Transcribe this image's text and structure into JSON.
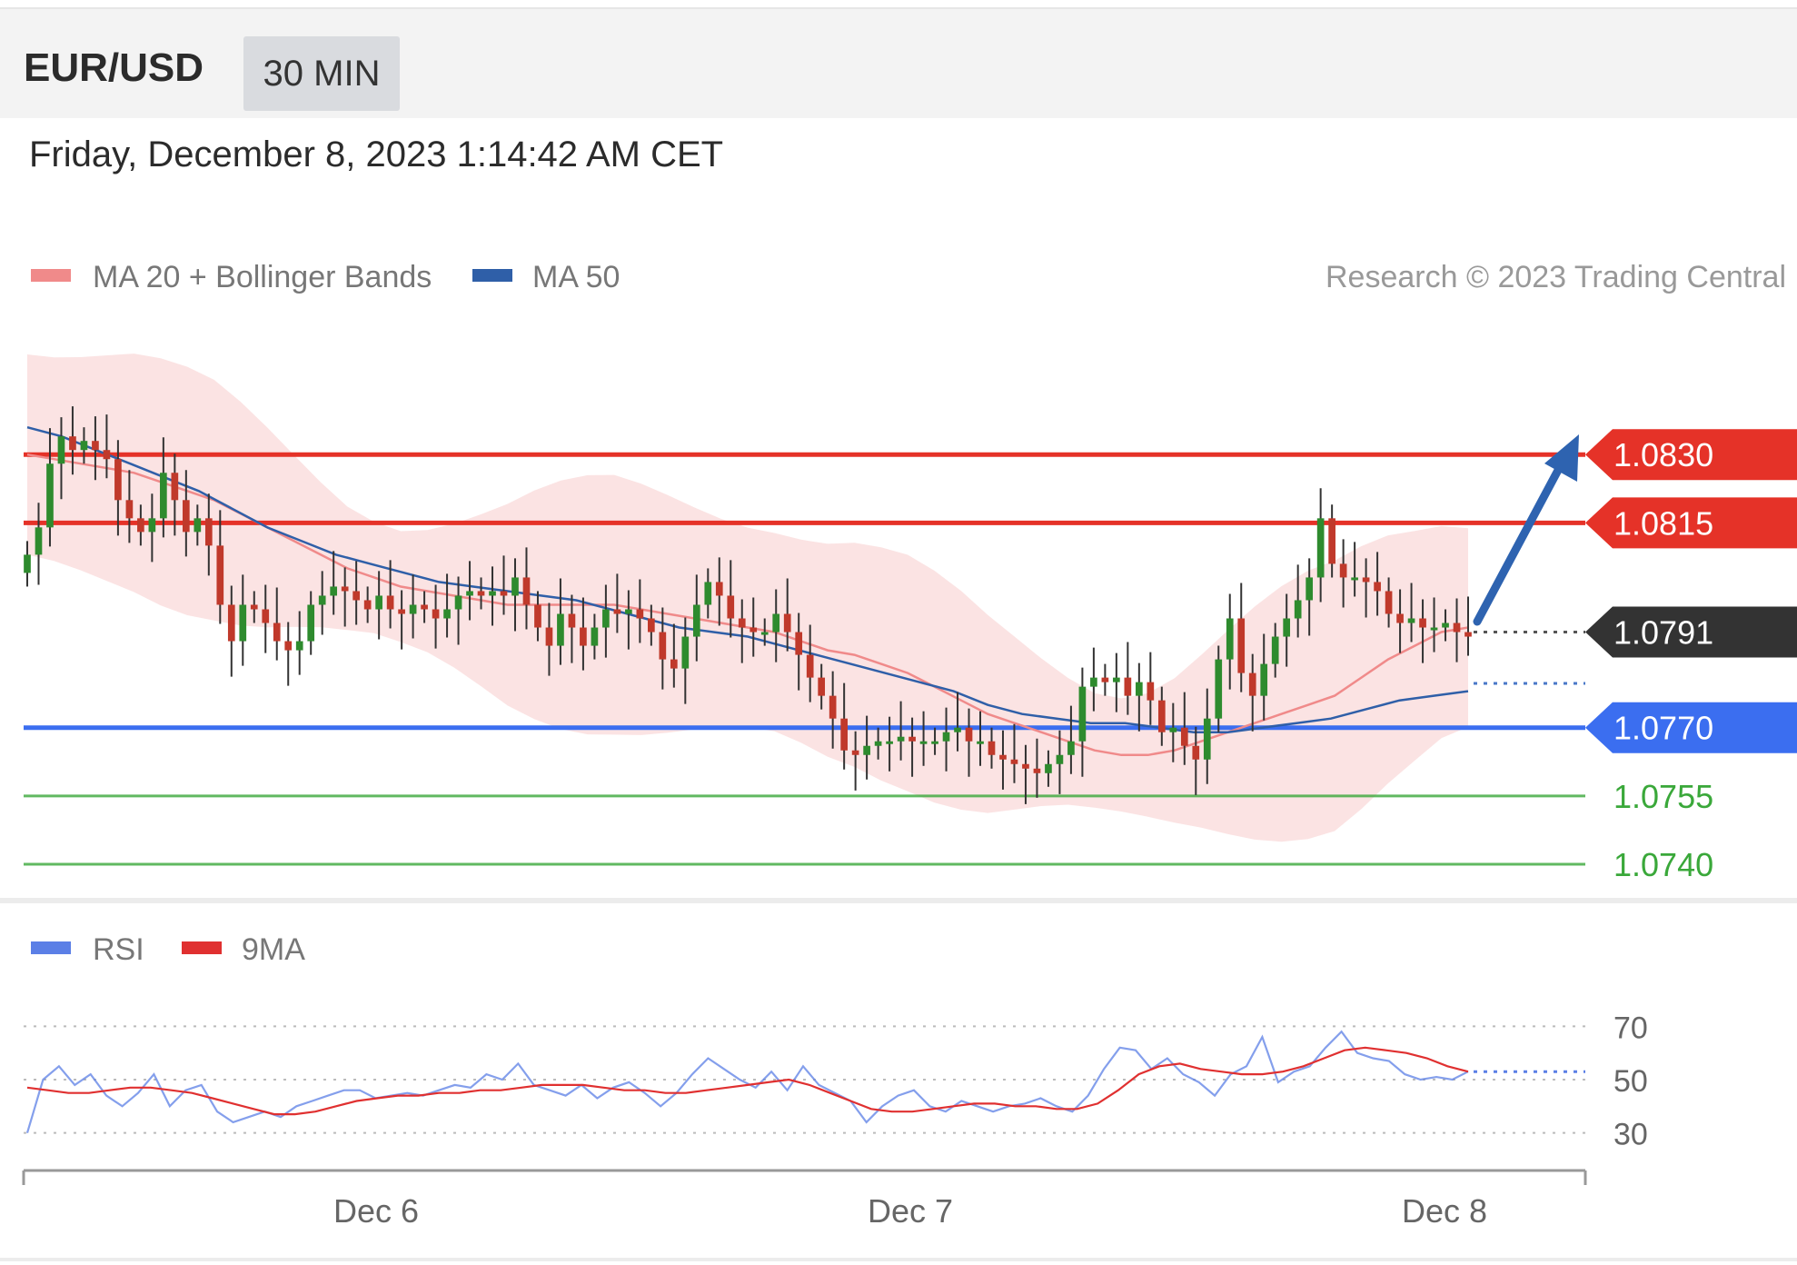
{
  "header": {
    "symbol": "EUR/USD",
    "timeframe": "30 MIN"
  },
  "datetime": "Friday, December 8, 2023 1:14:42 AM CET",
  "legend": {
    "ma20": {
      "label": "MA 20 + Bollinger Bands",
      "color": "#f08a8a"
    },
    "ma50": {
      "label": "MA 50",
      "color": "#2f5fa8"
    },
    "copyright": "Research © 2023 Trading Central"
  },
  "rsi_legend": {
    "rsi": {
      "label": "RSI",
      "color": "#5b7fe6"
    },
    "ma9": {
      "label": "9MA",
      "color": "#e03030"
    }
  },
  "colors": {
    "resistance": "#e53228",
    "support": "#3b6ef0",
    "target": "#3aa83a",
    "current": "#333333",
    "band": "#f9d9d9",
    "bull_candle": "#2e8b2e",
    "bear_candle": "#c0392b",
    "arrow": "#2e63b0"
  },
  "chart_data": [
    {
      "type": "candlestick",
      "title": "",
      "x_ticks": [
        "Dec 6",
        "Dec 7",
        "Dec 8"
      ],
      "ylim": [
        1.0733,
        1.0858
      ],
      "levels": [
        {
          "value": 1.083,
          "label": "1.0830",
          "kind": "resistance"
        },
        {
          "value": 1.0815,
          "label": "1.0815",
          "kind": "resistance"
        },
        {
          "value": 1.0791,
          "label": "1.0791",
          "kind": "current"
        },
        {
          "value": 1.077,
          "label": "1.0770",
          "kind": "support"
        },
        {
          "value": 1.0755,
          "label": "1.0755",
          "kind": "target"
        },
        {
          "value": 1.074,
          "label": "1.0740",
          "kind": "target"
        }
      ],
      "series": [
        {
          "name": "Price",
          "close": [
            1.0808,
            1.0814,
            1.0828,
            1.0834,
            1.0831,
            1.0833,
            1.0831,
            1.0829,
            1.082,
            1.0816,
            1.0813,
            1.0816,
            1.0826,
            1.082,
            1.0813,
            1.0816,
            1.081,
            1.0797,
            1.0789,
            1.0797,
            1.0796,
            1.0793,
            1.0789,
            1.0787,
            1.0789,
            1.0797,
            1.0799,
            1.0801,
            1.08,
            1.0798,
            1.0796,
            1.0799,
            1.0796,
            1.0795,
            1.0797,
            1.0796,
            1.0794,
            1.0796,
            1.0799,
            1.08,
            1.0799,
            1.08,
            1.0799,
            1.0803,
            1.0797,
            1.0792,
            1.0788,
            1.0795,
            1.0792,
            1.0788,
            1.0792,
            1.0796,
            1.0795,
            1.0796,
            1.0794,
            1.0791,
            1.0785,
            1.0783,
            1.079,
            1.0797,
            1.0802,
            1.0799,
            1.0794,
            1.0792,
            1.0791,
            1.0791,
            1.0795,
            1.0791,
            1.0786,
            1.0781,
            1.0777,
            1.0772,
            1.0765,
            1.0764,
            1.0766,
            1.0767,
            1.0767,
            1.0768,
            1.0767,
            1.0767,
            1.0767,
            1.0769,
            1.077,
            1.0767,
            1.0767,
            1.0764,
            1.0763,
            1.0762,
            1.0761,
            1.076,
            1.0762,
            1.0764,
            1.0767,
            1.0779,
            1.0781,
            1.078,
            1.0781,
            1.0777,
            1.078,
            1.0776,
            1.0769,
            1.077,
            1.0766,
            1.0763,
            1.0772,
            1.0785,
            1.0794,
            1.0782,
            1.0777,
            1.0784,
            1.079,
            1.0794,
            1.0798,
            1.0803,
            1.0816,
            1.0806,
            1.0803,
            1.0803,
            1.0802,
            1.08,
            1.0795,
            1.0793,
            1.0794,
            1.0792,
            1.0792,
            1.0793,
            1.0791,
            1.079
          ],
          "label_note": ""
        },
        {
          "name": "MA 20",
          "values": [
            1.083,
            1.0829,
            1.0828,
            1.0827,
            1.0826,
            1.0824,
            1.0822,
            1.082,
            1.0817,
            1.0814,
            1.0811,
            1.0808,
            1.0805,
            1.0803,
            1.0801,
            1.08,
            1.0799,
            1.0798,
            1.0797,
            1.0797,
            1.0797,
            1.0797,
            1.0797,
            1.0796,
            1.0795,
            1.0794,
            1.0793,
            1.0792,
            1.0791,
            1.0789,
            1.0787,
            1.0786,
            1.0784,
            1.0782,
            1.0779,
            1.0776,
            1.0773,
            1.0771,
            1.0769,
            1.0767,
            1.0765,
            1.0764,
            1.0764,
            1.0765,
            1.0767,
            1.0769,
            1.0771,
            1.0773,
            1.0775,
            1.0777,
            1.0781,
            1.0785,
            1.0788,
            1.0791,
            1.0792
          ]
        },
        {
          "name": "MA 50",
          "values": [
            1.0836,
            1.0834,
            1.0831,
            1.0828,
            1.0825,
            1.0822,
            1.0818,
            1.0814,
            1.0811,
            1.0808,
            1.0806,
            1.0804,
            1.0802,
            1.0801,
            1.08,
            1.0799,
            1.0798,
            1.0796,
            1.0794,
            1.0792,
            1.0791,
            1.079,
            1.0788,
            1.0786,
            1.0784,
            1.0782,
            1.078,
            1.0778,
            1.0775,
            1.0773,
            1.0772,
            1.0771,
            1.0771,
            1.077,
            1.0769,
            1.0769,
            1.077,
            1.0771,
            1.0772,
            1.0774,
            1.0776,
            1.0777,
            1.0778
          ]
        }
      ]
    },
    {
      "type": "line",
      "title": "",
      "y_ticks": [
        "70",
        "50",
        "30"
      ],
      "ylim": [
        20,
        80
      ],
      "series": [
        {
          "name": "RSI",
          "values": [
            30,
            50,
            55,
            48,
            52,
            44,
            40,
            45,
            52,
            40,
            46,
            48,
            38,
            34,
            36,
            38,
            36,
            40,
            42,
            44,
            46,
            46,
            43,
            44,
            45,
            44,
            46,
            48,
            47,
            52,
            50,
            56,
            48,
            46,
            44,
            48,
            43,
            47,
            49,
            45,
            40,
            45,
            52,
            58,
            54,
            50,
            47,
            53,
            46,
            55,
            48,
            45,
            42,
            34,
            40,
            44,
            46,
            40,
            38,
            42,
            40,
            38,
            40,
            41,
            43,
            40,
            38,
            44,
            54,
            62,
            61,
            54,
            58,
            52,
            49,
            44,
            52,
            55,
            66,
            49,
            53,
            55,
            62,
            68,
            60,
            58,
            57,
            52,
            50,
            51,
            50,
            53
          ]
        },
        {
          "name": "9MA",
          "values": [
            47,
            46,
            45,
            45,
            46,
            47,
            47,
            46,
            45,
            43,
            41,
            39,
            37,
            37,
            38,
            40,
            42,
            43,
            44,
            44,
            45,
            45,
            46,
            46,
            47,
            48,
            48,
            48,
            47,
            46,
            46,
            45,
            45,
            46,
            47,
            48,
            49,
            50,
            48,
            45,
            42,
            39,
            38,
            38,
            39,
            40,
            41,
            41,
            40,
            40,
            39,
            39,
            41,
            46,
            52,
            55,
            56,
            54,
            53,
            52,
            52,
            53,
            55,
            58,
            61,
            62,
            61,
            60,
            58,
            55,
            53
          ]
        }
      ]
    }
  ]
}
